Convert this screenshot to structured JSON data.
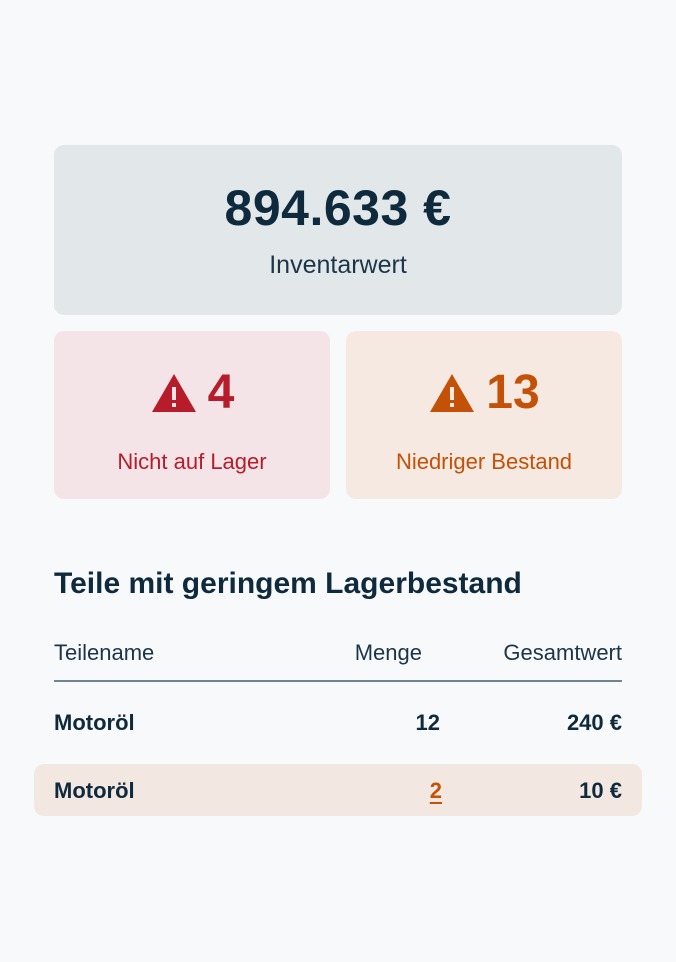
{
  "summary": {
    "total_value": "894.633 €",
    "total_label": "Inventarwert"
  },
  "alerts": {
    "out_of_stock": {
      "count": "4",
      "label": "Nicht auf Lager",
      "color": "#b71c2a",
      "icon": "warning-triangle-icon"
    },
    "low_stock": {
      "count": "13",
      "label": "Niedriger Bestand",
      "color": "#c35108",
      "icon": "warning-triangle-icon"
    }
  },
  "low_stock_table": {
    "title": "Teile mit geringem Lagerbestand",
    "columns": [
      "Teilename",
      "Menge",
      "Gesamtwert"
    ],
    "rows": [
      {
        "name": "Motoröl",
        "qty": "12",
        "total": "240 €"
      },
      {
        "name": "Motoröl",
        "qty": "2",
        "total": "10 €"
      }
    ]
  }
}
